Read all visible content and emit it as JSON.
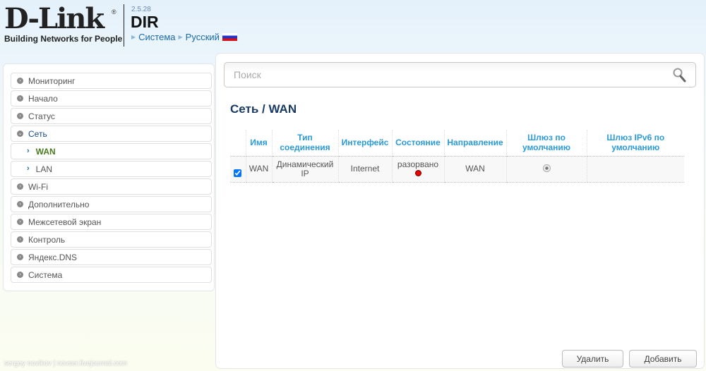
{
  "header": {
    "logo": "D-Link",
    "logo_reg": "®",
    "tagline": "Building Networks for People",
    "version": "2.5.28",
    "model": "DIR",
    "crumbs": [
      "Система",
      "Русский"
    ]
  },
  "sidebar": {
    "items": [
      {
        "label": "Мониторинг",
        "type": "top"
      },
      {
        "label": "Начало",
        "type": "top"
      },
      {
        "label": "Статус",
        "type": "top"
      },
      {
        "label": "Сеть",
        "type": "open"
      },
      {
        "label": "WAN",
        "type": "sub-active"
      },
      {
        "label": "LAN",
        "type": "sub"
      },
      {
        "label": "Wi-Fi",
        "type": "top"
      },
      {
        "label": "Дополнительно",
        "type": "top"
      },
      {
        "label": "Межсетевой экран",
        "type": "top"
      },
      {
        "label": "Контроль",
        "type": "top"
      },
      {
        "label": "Яндекс.DNS",
        "type": "top"
      },
      {
        "label": "Система",
        "type": "top"
      }
    ]
  },
  "search": {
    "placeholder": "Поиск",
    "value": ""
  },
  "page": {
    "title": "Сеть /  WAN"
  },
  "table": {
    "headers": [
      "Имя",
      "Тип соединения",
      "Интерфейс",
      "Состояние",
      "Направление",
      "Шлюз по умолчанию",
      "Шлюз IPv6 по умолчанию"
    ],
    "rows": [
      {
        "checked": true,
        "name": "WAN",
        "type": "Динамический IP",
        "interface": "Internet",
        "state": "разорвано",
        "state_color": "#e00000",
        "direction": "WAN",
        "default_gw": true,
        "default_gw6": ""
      }
    ]
  },
  "buttons": {
    "delete": "Удалить",
    "add": "Добавить"
  },
  "watermark": "sergey novikov | novser.livejournal.com"
}
